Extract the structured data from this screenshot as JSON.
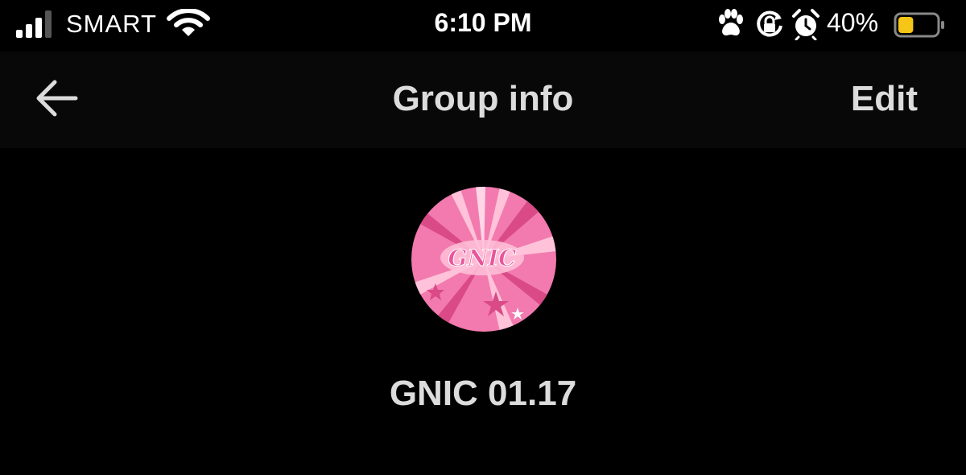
{
  "status_bar": {
    "carrier": "SMART",
    "time": "6:10 PM",
    "battery_percent": "40%",
    "battery_level": 0.4,
    "battery_color": "#F5C518",
    "signal_bars_active": 3,
    "icons": [
      "signal-icon",
      "wifi-icon",
      "paw-icon",
      "rotation-lock-icon",
      "alarm-icon",
      "battery-icon"
    ]
  },
  "header": {
    "back_icon": "arrow-left-icon",
    "title": "Group info",
    "edit_label": "Edit"
  },
  "group": {
    "avatar_text": "GNIC",
    "name": "GNIC 01.17",
    "avatar_colors": {
      "base": "#F27AAE",
      "burst": "#FFC2D9",
      "accent": "#D94A86"
    }
  },
  "theme": {
    "background": "#000000",
    "header_bg": "#080808",
    "text": "#DCDCDC"
  }
}
